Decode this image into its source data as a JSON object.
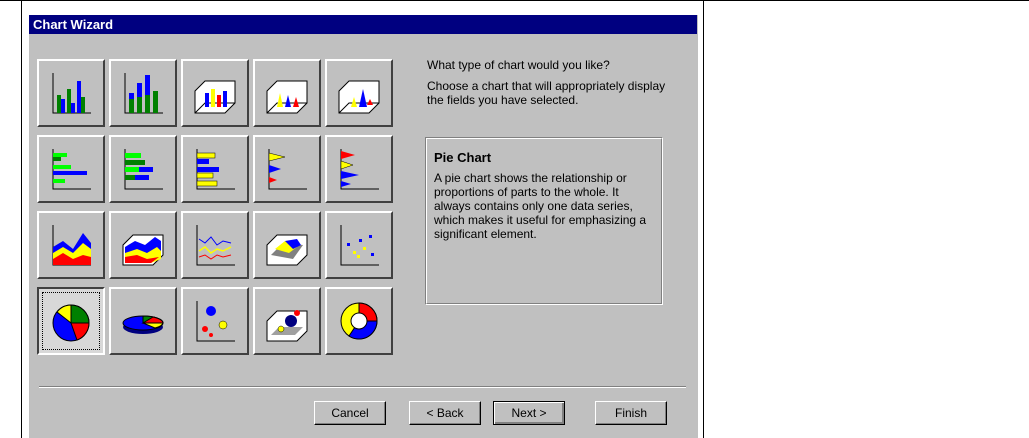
{
  "window": {
    "title": "Chart Wizard"
  },
  "prompt": {
    "question": "What type of chart would you like?",
    "instruction": "Choose a chart that will appropriately display the fields you have selected."
  },
  "description": {
    "title": "Pie Chart",
    "body": "A pie chart shows the relationship or proportions of parts to the whole. It always contains only one data series, which makes it useful for emphasizing a significant element."
  },
  "chart_types": [
    {
      "icon": "column-chart-icon"
    },
    {
      "icon": "stacked-column-chart-icon"
    },
    {
      "icon": "3d-column-chart-icon"
    },
    {
      "icon": "3d-cone-chart-icon"
    },
    {
      "icon": "3d-pyramid-chart-icon"
    },
    {
      "icon": "bar-chart-icon"
    },
    {
      "icon": "stacked-bar-chart-icon"
    },
    {
      "icon": "3d-bar-chart-icon"
    },
    {
      "icon": "3d-cone-bar-chart-icon"
    },
    {
      "icon": "3d-pyramid-bar-chart-icon"
    },
    {
      "icon": "area-chart-icon"
    },
    {
      "icon": "3d-area-chart-icon"
    },
    {
      "icon": "line-chart-icon"
    },
    {
      "icon": "3d-surface-chart-icon"
    },
    {
      "icon": "scatter-chart-icon"
    },
    {
      "icon": "pie-chart-icon",
      "selected": true
    },
    {
      "icon": "3d-pie-chart-icon"
    },
    {
      "icon": "bubble-chart-icon"
    },
    {
      "icon": "3d-bubble-chart-icon"
    },
    {
      "icon": "doughnut-chart-icon"
    }
  ],
  "buttons": {
    "cancel": "Cancel",
    "back": "< Back",
    "next": "Next >",
    "finish": "Finish"
  }
}
